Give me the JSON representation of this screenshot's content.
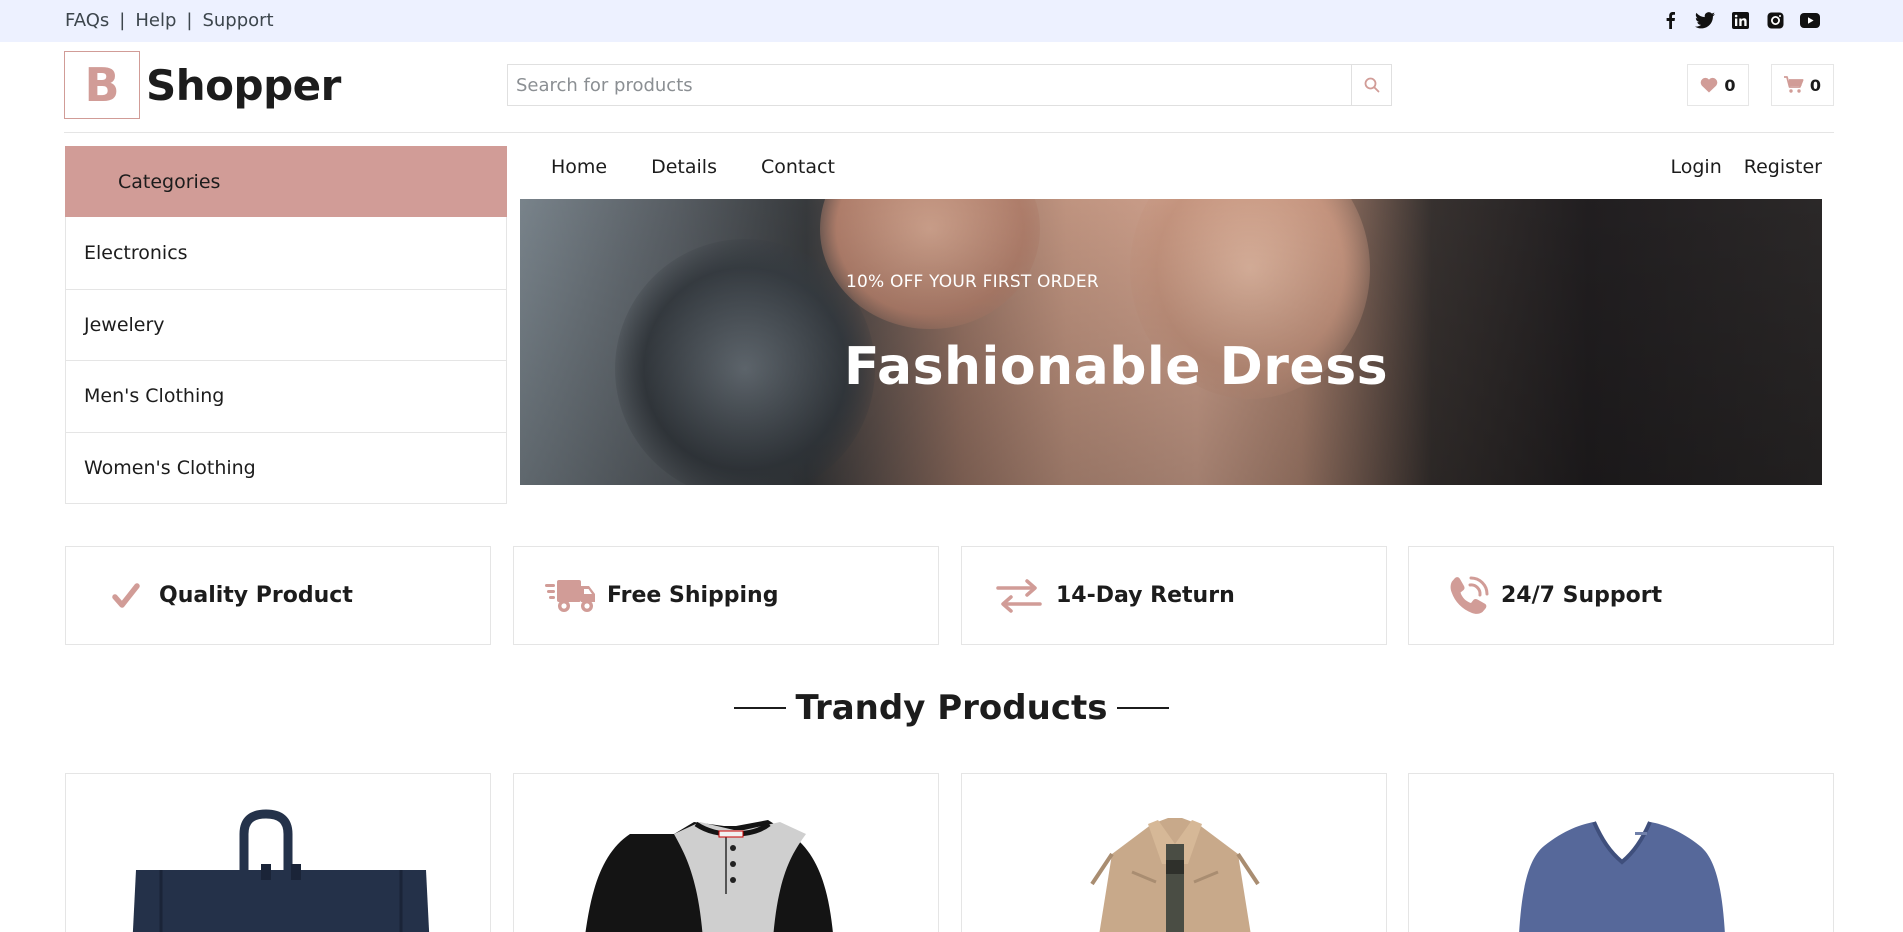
{
  "topbar": {
    "links": [
      "FAQs",
      "Help",
      "Support"
    ],
    "separator": "|",
    "social_icons": [
      "facebook-icon",
      "twitter-icon",
      "linkedin-icon",
      "instagram-icon",
      "youtube-icon"
    ]
  },
  "brand": {
    "letter": "B",
    "name": "Shopper"
  },
  "search": {
    "placeholder": "Search for products",
    "value": ""
  },
  "header": {
    "wishlist_count": "0",
    "cart_count": "0"
  },
  "categories": {
    "title": "Categories",
    "items": [
      "Electronics",
      "Jewelery",
      "Men's Clothing",
      "Women's Clothing"
    ]
  },
  "nav": {
    "items": [
      "Home",
      "Details",
      "Contact"
    ],
    "login": "Login",
    "register": "Register"
  },
  "banner": {
    "subtitle": "10% OFF YOUR FIRST ORDER",
    "title": "Fashionable Dress"
  },
  "features": [
    {
      "label": "Quality Product",
      "icon": "check-icon"
    },
    {
      "label": "Free Shipping",
      "icon": "shipping-truck-icon"
    },
    {
      "label": "14-Day Return",
      "icon": "exchange-arrows-icon"
    },
    {
      "label": "24/7 Support",
      "icon": "phone-volume-icon"
    }
  ],
  "section": {
    "title": "Trandy Products"
  },
  "colors": {
    "accent": "#d19c97",
    "topbar_bg": "#edf1ff",
    "text": "#1c1c1c"
  },
  "products": [
    {
      "image": "backpack"
    },
    {
      "image": "raglan-shirt"
    },
    {
      "image": "jacket"
    },
    {
      "image": "v-neck-tee"
    }
  ]
}
